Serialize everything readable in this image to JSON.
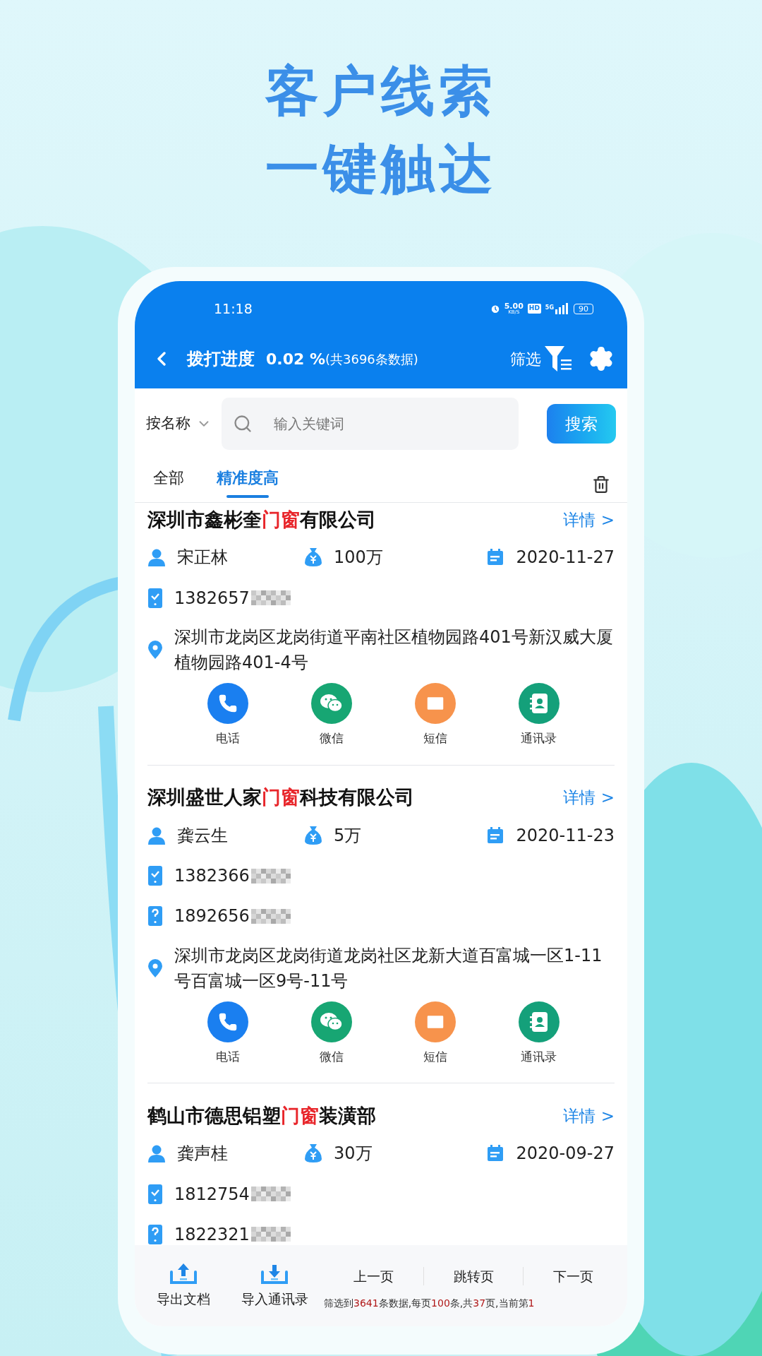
{
  "headline": [
    "客户线索",
    "一键触达"
  ],
  "status_bar": {
    "time": "11:18",
    "net_speed": "5.00",
    "net_unit": "KB/S",
    "hd": "HD",
    "network": "5G",
    "battery": "90"
  },
  "header": {
    "title": "拨打进度",
    "progress": "0.02 %",
    "total": "(共3696条数据)",
    "filter": "筛选"
  },
  "search": {
    "field": "按名称",
    "placeholder": "输入关键词",
    "button": "搜索"
  },
  "tabs": [
    {
      "label": "全部",
      "selected": false
    },
    {
      "label": "精准度高",
      "selected": true
    }
  ],
  "leads": [
    {
      "name_before": "深圳市鑫彬奎",
      "keyword": "门窗",
      "name_after": "有限公司",
      "detail": "详情 >",
      "contact": "宋正林",
      "capital": "100万",
      "date": "2020-11-27",
      "phones": [
        {
          "number": "1382657",
          "kind": "verified"
        }
      ],
      "address": "深圳市龙岗区龙岗街道平南社区植物园路401号新汉威大厦植物园路401-4号",
      "actions": [
        {
          "label": "电话",
          "kind": "phone",
          "color": "#1a7ff0"
        },
        {
          "label": "微信",
          "kind": "wechat",
          "color": "#17a673"
        },
        {
          "label": "短信",
          "kind": "sms",
          "color": "#f7934c"
        },
        {
          "label": "通讯录",
          "kind": "contacts",
          "color": "#14a07a"
        }
      ]
    },
    {
      "name_before": "深圳盛世人家",
      "keyword": "门窗",
      "name_after": "科技有限公司",
      "detail": "详情 >",
      "contact": "龚云生",
      "capital": "5万",
      "date": "2020-11-23",
      "phones": [
        {
          "number": "1382366",
          "kind": "verified"
        },
        {
          "number": "1892656",
          "kind": "unknown"
        }
      ],
      "address": "深圳市龙岗区龙岗街道龙岗社区龙新大道百富城一区1-11号百富城一区9号-11号",
      "actions": [
        {
          "label": "电话",
          "kind": "phone",
          "color": "#1a7ff0"
        },
        {
          "label": "微信",
          "kind": "wechat",
          "color": "#17a673"
        },
        {
          "label": "短信",
          "kind": "sms",
          "color": "#f7934c"
        },
        {
          "label": "通讯录",
          "kind": "contacts",
          "color": "#14a07a"
        }
      ]
    },
    {
      "name_before": "鹤山市德思铝塑",
      "keyword": "门窗",
      "name_after": "装潢部",
      "detail": "详情 >",
      "contact": "龚声桂",
      "capital": "30万",
      "date": "2020-09-27",
      "phones": [
        {
          "number": "1812754",
          "kind": "verified"
        },
        {
          "number": "1822321",
          "kind": "unknown"
        }
      ]
    }
  ],
  "footer": {
    "export": "导出文档",
    "import": "导入通讯录",
    "prev": "上一页",
    "jump": "跳转页",
    "next": "下一页",
    "summary": [
      {
        "text": "筛选到",
        "highlight": false
      },
      {
        "text": "3641",
        "highlight": true
      },
      {
        "text": "条数据,每页",
        "highlight": false
      },
      {
        "text": "100",
        "highlight": true
      },
      {
        "text": "条,共",
        "highlight": false
      },
      {
        "text": "37",
        "highlight": true
      },
      {
        "text": "页,当前第",
        "highlight": false
      },
      {
        "text": "1",
        "highlight": true
      }
    ]
  }
}
